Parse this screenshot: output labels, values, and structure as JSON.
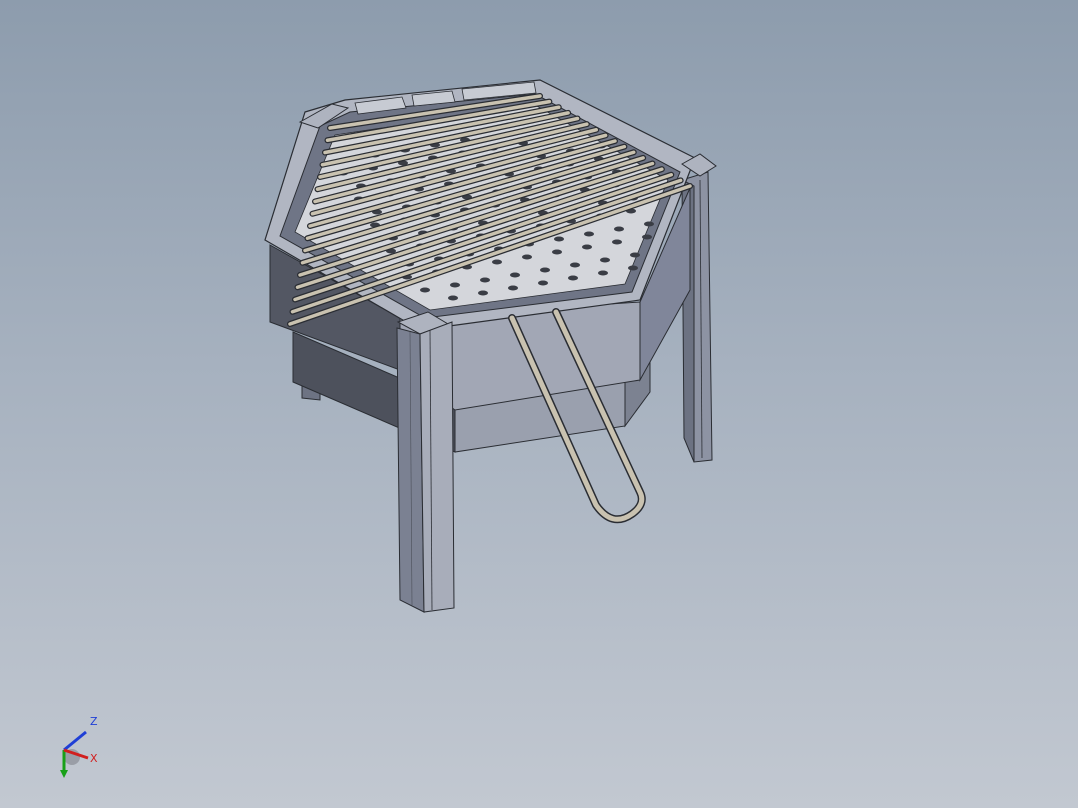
{
  "viewport": {
    "background_top": "#8d9cad",
    "background_bottom": "#c2c8d1"
  },
  "model": {
    "subject": "hexagonal-bbq-grill",
    "colors": {
      "body_dark": "#5a5e6a",
      "body_mid": "#7e8596",
      "body_light": "#a4aab8",
      "rim": "#9aa1b1",
      "grate_rod": "#c9c2b0",
      "edge": "#2a2d33",
      "tray": "#d7d9de"
    }
  },
  "triad": {
    "z_label": "Z",
    "x_label": "X",
    "z_color": "#1f3fd6",
    "x_color": "#d11f1f",
    "y_color": "#18a018"
  }
}
